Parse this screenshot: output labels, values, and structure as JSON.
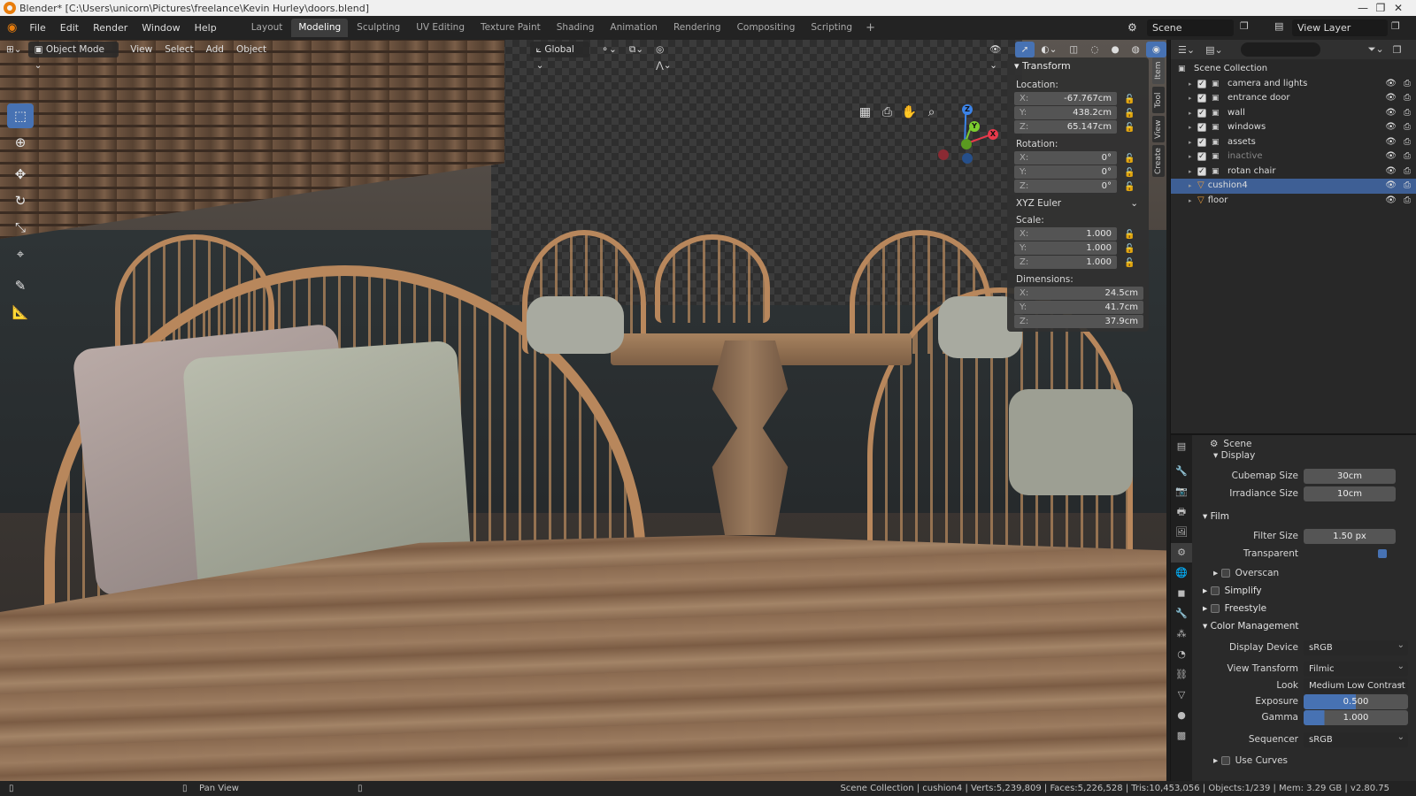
{
  "window": {
    "title": "Blender* [C:\\Users\\unicorn\\Pictures\\freelance\\Kevin Hurley\\doors.blend]",
    "controls": [
      "—",
      "❐",
      "✕"
    ]
  },
  "menu": [
    "File",
    "Edit",
    "Render",
    "Window",
    "Help"
  ],
  "workspaces": [
    {
      "label": "Layout",
      "active": false
    },
    {
      "label": "Modeling",
      "active": true
    },
    {
      "label": "Sculpting",
      "active": false
    },
    {
      "label": "UV Editing",
      "active": false
    },
    {
      "label": "Texture Paint",
      "active": false
    },
    {
      "label": "Shading",
      "active": false
    },
    {
      "label": "Animation",
      "active": false
    },
    {
      "label": "Rendering",
      "active": false
    },
    {
      "label": "Compositing",
      "active": false
    },
    {
      "label": "Scripting",
      "active": false
    }
  ],
  "scene_field": "Scene",
  "view_layer_field": "View Layer",
  "viewport_header": {
    "mode": "Object Mode",
    "menus": [
      "View",
      "Select",
      "Add",
      "Object"
    ],
    "orientation": "Global"
  },
  "gizmo": {
    "z": "Z",
    "y": "Y",
    "x": "X",
    "x_color": "#e8394b",
    "y_color": "#7ccd2f",
    "z_color": "#3b83e8"
  },
  "npanel": {
    "title": "Transform",
    "location_label": "Location:",
    "location": [
      {
        "axis": "X:",
        "value": "-67.767cm"
      },
      {
        "axis": "Y:",
        "value": "438.2cm"
      },
      {
        "axis": "Z:",
        "value": "65.147cm"
      }
    ],
    "rotation_label": "Rotation:",
    "rotation": [
      {
        "axis": "X:",
        "value": "0°"
      },
      {
        "axis": "Y:",
        "value": "0°"
      },
      {
        "axis": "Z:",
        "value": "0°"
      }
    ],
    "rotation_mode": "XYZ Euler",
    "scale_label": "Scale:",
    "scale": [
      {
        "axis": "X:",
        "value": "1.000"
      },
      {
        "axis": "Y:",
        "value": "1.000"
      },
      {
        "axis": "Z:",
        "value": "1.000"
      }
    ],
    "dimensions_label": "Dimensions:",
    "dimensions": [
      {
        "axis": "X:",
        "value": "24.5cm"
      },
      {
        "axis": "Y:",
        "value": "41.7cm"
      },
      {
        "axis": "Z:",
        "value": "37.9cm"
      }
    ],
    "tabs": [
      "Item",
      "Tool",
      "View",
      "Create"
    ]
  },
  "outliner": {
    "root": "Scene Collection",
    "items": [
      {
        "name": "camera and lights",
        "type": "collection",
        "selected": false,
        "dim": false
      },
      {
        "name": "entrance door",
        "type": "collection",
        "selected": false,
        "dim": false
      },
      {
        "name": "wall",
        "type": "collection",
        "selected": false,
        "dim": false
      },
      {
        "name": "windows",
        "type": "collection",
        "selected": false,
        "dim": false
      },
      {
        "name": "assets",
        "type": "collection",
        "selected": false,
        "dim": false
      },
      {
        "name": "inactive",
        "type": "collection",
        "selected": false,
        "dim": true
      },
      {
        "name": "rotan chair",
        "type": "collection",
        "selected": false,
        "dim": false
      },
      {
        "name": "cushion4",
        "type": "object",
        "selected": true,
        "dim": false
      },
      {
        "name": "floor",
        "type": "object",
        "selected": false,
        "dim": false
      }
    ]
  },
  "properties": {
    "context": "Scene",
    "display_header": "Display",
    "cubemap_label": "Cubemap Size",
    "cubemap_value": "30cm",
    "irradiance_label": "Irradiance Size",
    "irradiance_value": "10cm",
    "film_header": "Film",
    "filter_label": "Filter Size",
    "filter_value": "1.50 px",
    "transparent_label": "Transparent",
    "overscan_label": "Overscan",
    "simplify_label": "Simplify",
    "freestyle_label": "Freestyle",
    "color_mgmt_header": "Color Management",
    "display_device_label": "Display Device",
    "display_device_value": "sRGB",
    "view_transform_label": "View Transform",
    "view_transform_value": "Filmic",
    "look_label": "Look",
    "look_value": "Medium Low Contrast",
    "exposure_label": "Exposure",
    "exposure_value": "0.500",
    "exposure_fill": 0.5,
    "gamma_label": "Gamma",
    "gamma_value": "1.000",
    "gamma_fill": 0.2,
    "sequencer_label": "Sequencer",
    "sequencer_value": "sRGB",
    "use_curves_label": "Use Curves"
  },
  "status": {
    "pan_view": "Pan View",
    "stats": "Scene Collection | cushion4 | Verts:5,239,809 | Faces:5,226,528 | Tris:10,453,056 | Objects:1/239 | Mem: 3.29 GB | v2.80.75"
  }
}
